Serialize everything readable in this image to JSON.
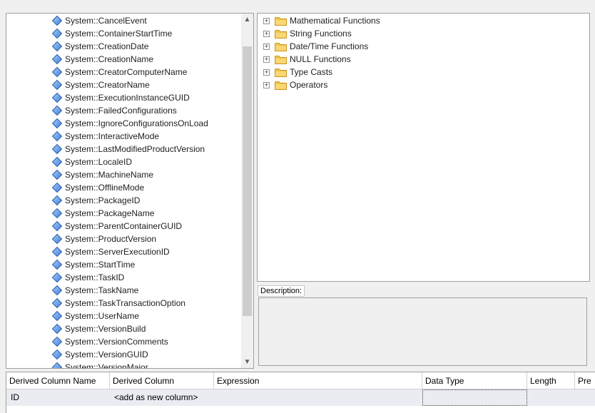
{
  "variables": {
    "items": [
      "System::CancelEvent",
      "System::ContainerStartTime",
      "System::CreationDate",
      "System::CreationName",
      "System::CreatorComputerName",
      "System::CreatorName",
      "System::ExecutionInstanceGUID",
      "System::FailedConfigurations",
      "System::IgnoreConfigurationsOnLoad",
      "System::InteractiveMode",
      "System::LastModifiedProductVersion",
      "System::LocaleID",
      "System::MachineName",
      "System::OfflineMode",
      "System::PackageID",
      "System::PackageName",
      "System::ParentContainerGUID",
      "System::ProductVersion",
      "System::ServerExecutionID",
      "System::StartTime",
      "System::TaskID",
      "System::TaskName",
      "System::TaskTransactionOption",
      "System::UserName",
      "System::VersionBuild",
      "System::VersionComments",
      "System::VersionGUID",
      "System::VersionMajor"
    ],
    "icon": "variable-diamond-icon"
  },
  "functions": {
    "items": [
      "Mathematical Functions",
      "String Functions",
      "Date/Time Functions",
      "NULL Functions",
      "Type Casts",
      "Operators"
    ],
    "expander": "+",
    "icon": "folder-icon"
  },
  "description": {
    "label": "Description:"
  },
  "grid": {
    "columns": [
      "Derived Column Name",
      "Derived Column",
      "Expression",
      "Data Type",
      "Length",
      "Pre"
    ],
    "rows": [
      [
        "ID",
        "<add as new column>",
        "",
        "",
        "",
        ""
      ]
    ]
  },
  "scrollbar": {
    "up": "▲",
    "down": "▼"
  },
  "colors": {
    "diamond_fill": "#3f7fd9",
    "folder_fill": "#f2c64a",
    "row_highlight": "#e9ecf1"
  }
}
